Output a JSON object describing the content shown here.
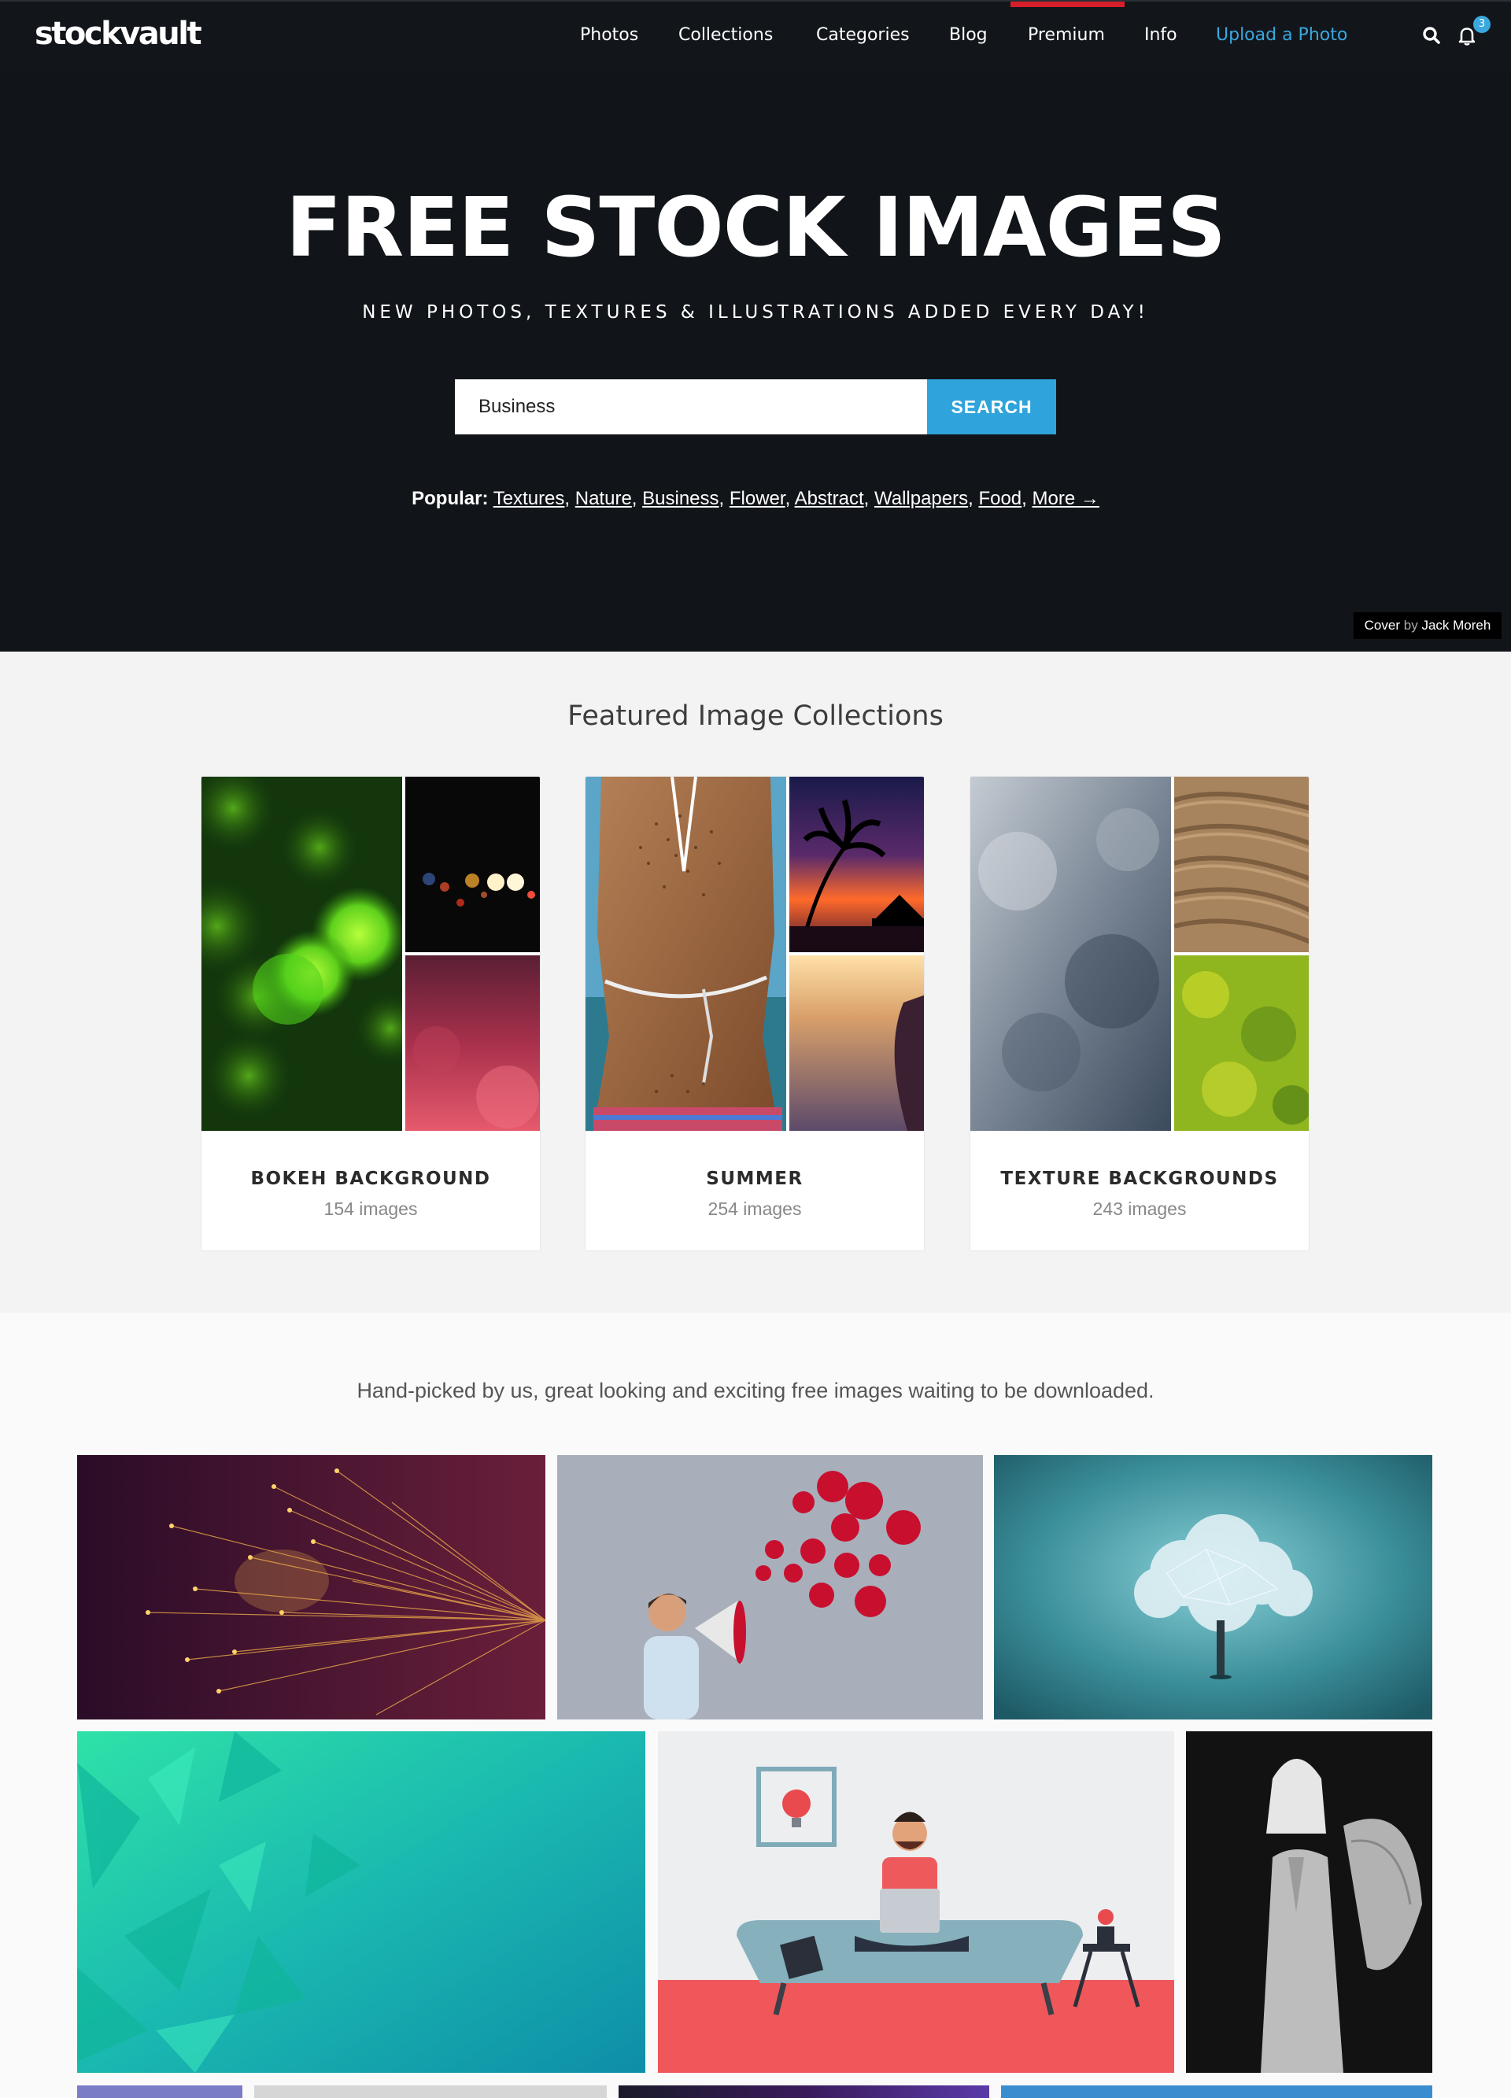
{
  "brand": {
    "logo": "stockvault"
  },
  "nav": {
    "items": [
      "Photos",
      "Collections",
      "Categories",
      "Blog",
      "Premium",
      "Info"
    ],
    "upload": "Upload a Photo",
    "notification_count": "3",
    "icons": [
      "search-icon",
      "bell-icon"
    ],
    "accent_color": "#3aa7df",
    "active_marker_color": "#d51f2a"
  },
  "hero": {
    "title": "FREE STOCK IMAGES",
    "subtitle": "NEW PHOTOS, TEXTURES & ILLUSTRATIONS ADDED EVERY DAY!",
    "search_value": "Business",
    "search_button": "SEARCH",
    "popular_label": "Popular:",
    "popular_links": [
      "Textures",
      "Nature",
      "Business",
      "Flower",
      "Abstract",
      "Wallpapers",
      "Food",
      "More →"
    ],
    "credit_prefix": "Cover",
    "credit_by": "by",
    "credit_author": "Jack Moreh"
  },
  "featured": {
    "title": "Featured Image Collections",
    "collections": [
      {
        "name": "BOKEH BACKGROUND",
        "count": "154 images"
      },
      {
        "name": "SUMMER",
        "count": "254 images"
      },
      {
        "name": "TEXTURE BACKGROUNDS",
        "count": "243 images"
      }
    ]
  },
  "grid": {
    "tagline": "Hand-picked by us, great looking and exciting free images waiting to be downloaded."
  }
}
